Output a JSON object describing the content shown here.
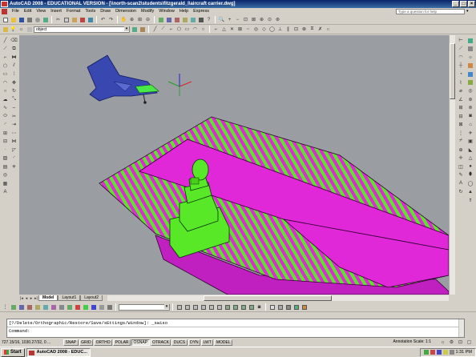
{
  "window": {
    "title": "AutoCAD 2008 - EDUCATIONAL VERSION - [\\\\north-scan2\\students\\fitzgerald_l\\aircraft carrier.dwg]",
    "min": "_",
    "max": "□",
    "close": "×"
  },
  "menu": {
    "items": [
      "File",
      "Edit",
      "View",
      "Insert",
      "Format",
      "Tools",
      "Draw",
      "Dimension",
      "Modify",
      "Window",
      "Help",
      "Express"
    ],
    "help_placeholder": "Type a question for help"
  },
  "layers": {
    "current_layer": "object"
  },
  "tabs": {
    "items": [
      "Model",
      "Layout1",
      "Layout2"
    ],
    "active": "Model"
  },
  "command": {
    "history": "[?/Delete/Orthographic/Restore/Save/sEttings/Window]: _swiso",
    "prompt": "Command:"
  },
  "status": {
    "coords": "727.15/16,  1030.27/32, 0 ...",
    "toggles": [
      "SNAP",
      "GRID",
      "ORTHO",
      "POLAR",
      "OSNAP",
      "OTRACK",
      "DUCS",
      "DYN",
      "LWT",
      "MODEL"
    ],
    "annotation_scale_label": "Annotation Scale:",
    "annotation_scale_value": "1:1"
  },
  "taskbar": {
    "start": "Start",
    "task": "AutoCAD 2008 - EDUC...",
    "clock": "1:31 PM"
  },
  "colors": {
    "magenta_deck": "#e028d8",
    "green_deck": "#58e828",
    "viewport_bg": "#9a9ea3",
    "jet_blue": "#3848b0"
  }
}
